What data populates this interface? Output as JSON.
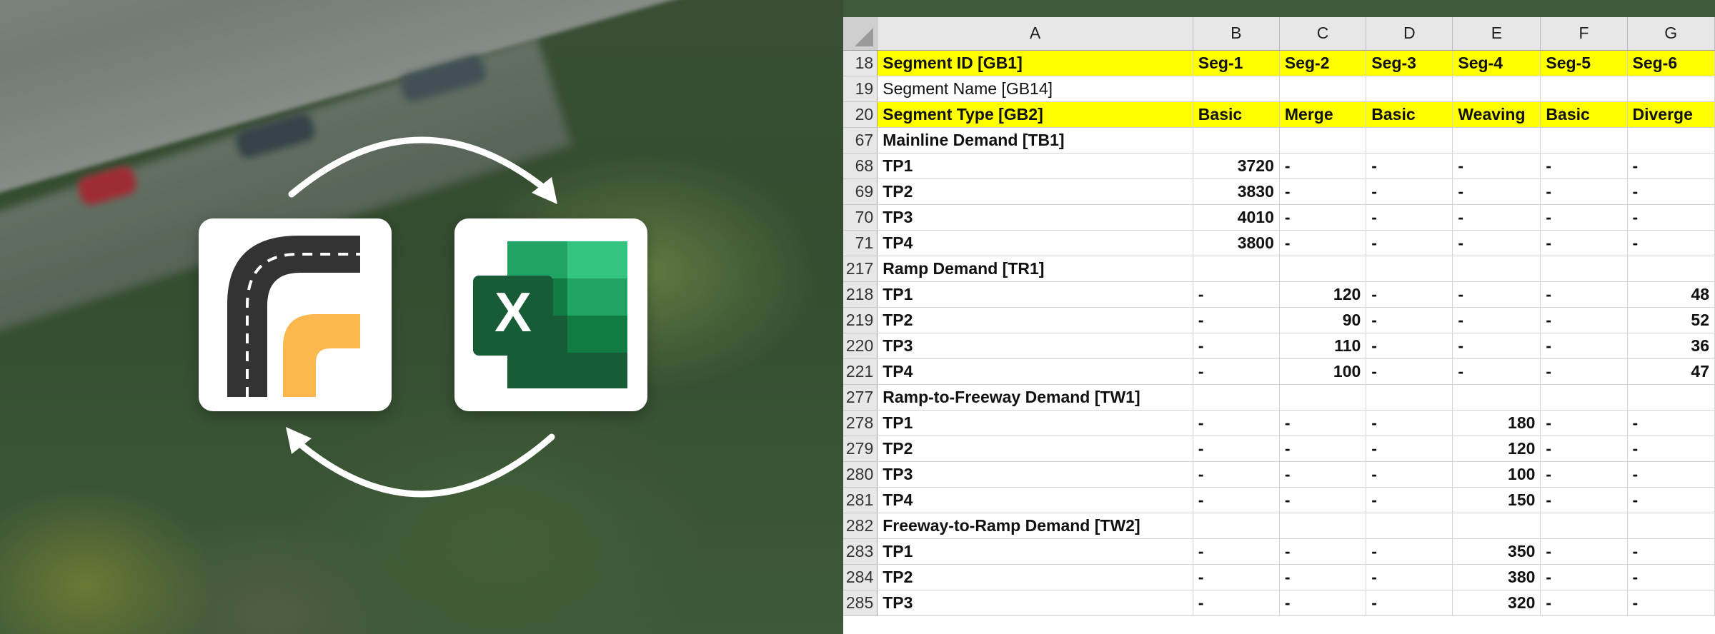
{
  "spreadsheet": {
    "columns": [
      "A",
      "B",
      "C",
      "D",
      "E",
      "F",
      "G"
    ],
    "rows": [
      {
        "num": "18",
        "highlight": true,
        "bold": true,
        "cells": [
          "Segment ID [GB1]",
          "Seg-1",
          "Seg-2",
          "Seg-3",
          "Seg-4",
          "Seg-5",
          "Seg-6"
        ]
      },
      {
        "num": "19",
        "highlight": false,
        "bold": false,
        "cells": [
          "Segment Name [GB14]",
          "",
          "",
          "",
          "",
          "",
          ""
        ]
      },
      {
        "num": "20",
        "highlight": true,
        "bold": true,
        "cells": [
          "Segment Type [GB2]",
          "Basic",
          "Merge",
          "Basic",
          "Weaving",
          "Basic",
          "Diverge"
        ]
      },
      {
        "num": "67",
        "highlight": false,
        "bold": true,
        "cells": [
          "Mainline Demand [TB1]",
          "",
          "",
          "",
          "",
          "",
          ""
        ]
      },
      {
        "num": "68",
        "highlight": false,
        "bold": true,
        "cells": [
          "TP1",
          "3720",
          "-",
          "-",
          "-",
          "-",
          "-"
        ]
      },
      {
        "num": "69",
        "highlight": false,
        "bold": true,
        "cells": [
          "TP2",
          "3830",
          "-",
          "-",
          "-",
          "-",
          "-"
        ]
      },
      {
        "num": "70",
        "highlight": false,
        "bold": true,
        "cells": [
          "TP3",
          "4010",
          "-",
          "-",
          "-",
          "-",
          "-"
        ]
      },
      {
        "num": "71",
        "highlight": false,
        "bold": true,
        "cells": [
          "TP4",
          "3800",
          "-",
          "-",
          "-",
          "-",
          "-"
        ]
      },
      {
        "num": "217",
        "highlight": false,
        "bold": true,
        "cells": [
          "Ramp Demand [TR1]",
          "",
          "",
          "",
          "",
          "",
          ""
        ]
      },
      {
        "num": "218",
        "highlight": false,
        "bold": true,
        "cells": [
          "TP1",
          "-",
          "120",
          "-",
          "-",
          "-",
          "48"
        ]
      },
      {
        "num": "219",
        "highlight": false,
        "bold": true,
        "cells": [
          "TP2",
          "-",
          "90",
          "-",
          "-",
          "-",
          "52"
        ]
      },
      {
        "num": "220",
        "highlight": false,
        "bold": true,
        "cells": [
          "TP3",
          "-",
          "110",
          "-",
          "-",
          "-",
          "36"
        ]
      },
      {
        "num": "221",
        "highlight": false,
        "bold": true,
        "cells": [
          "TP4",
          "-",
          "100",
          "-",
          "-",
          "-",
          "47"
        ]
      },
      {
        "num": "277",
        "highlight": false,
        "bold": true,
        "cells": [
          "Ramp-to-Freeway Demand [TW1]",
          "",
          "",
          "",
          "",
          "",
          ""
        ]
      },
      {
        "num": "278",
        "highlight": false,
        "bold": true,
        "cells": [
          "TP1",
          "-",
          "-",
          "-",
          "180",
          "-",
          "-"
        ]
      },
      {
        "num": "279",
        "highlight": false,
        "bold": true,
        "cells": [
          "TP2",
          "-",
          "-",
          "-",
          "120",
          "-",
          "-"
        ]
      },
      {
        "num": "280",
        "highlight": false,
        "bold": true,
        "cells": [
          "TP3",
          "-",
          "-",
          "-",
          "100",
          "-",
          "-"
        ]
      },
      {
        "num": "281",
        "highlight": false,
        "bold": true,
        "cells": [
          "TP4",
          "-",
          "-",
          "-",
          "150",
          "-",
          "-"
        ]
      },
      {
        "num": "282",
        "highlight": false,
        "bold": true,
        "cells": [
          "Freeway-to-Ramp Demand [TW2]",
          "",
          "",
          "",
          "",
          "",
          ""
        ]
      },
      {
        "num": "283",
        "highlight": false,
        "bold": true,
        "cells": [
          "TP1",
          "-",
          "-",
          "-",
          "350",
          "-",
          "-"
        ]
      },
      {
        "num": "284",
        "highlight": false,
        "bold": true,
        "cells": [
          "TP2",
          "-",
          "-",
          "-",
          "380",
          "-",
          "-"
        ]
      },
      {
        "num": "285",
        "highlight": false,
        "bold": true,
        "cells": [
          "TP3",
          "-",
          "-",
          "-",
          "320",
          "-",
          "-"
        ]
      }
    ]
  },
  "logos": {
    "excel_letter": "X",
    "road_dark": "#333333",
    "road_accent": "#fbb84e",
    "excel_green_dark": "#185c37",
    "excel_green": "#21a366",
    "highlight_color": "#ffff00"
  },
  "icons": [
    "road-app-logo",
    "excel-logo",
    "sync-arrow-top-icon",
    "sync-arrow-bottom-icon"
  ]
}
